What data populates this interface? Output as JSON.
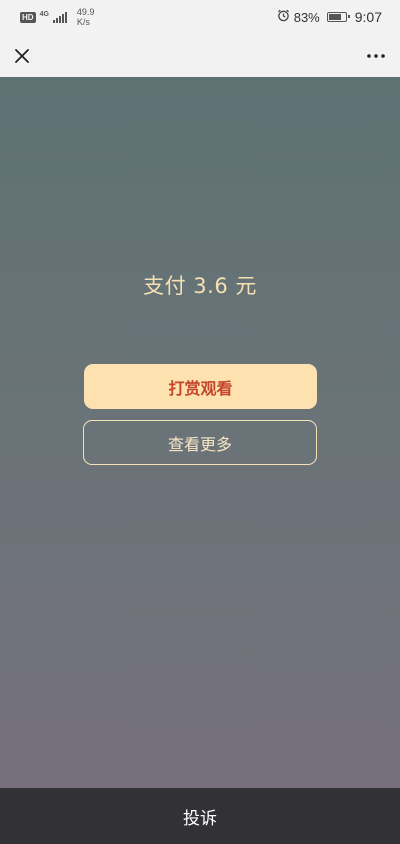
{
  "status_bar": {
    "hd": "HD",
    "network": "4G",
    "speed_value": "49.9",
    "speed_unit": "K/s",
    "battery": "83%",
    "battery_level": 0.83,
    "time": "9:07"
  },
  "nav": {
    "close_icon": "close-icon",
    "more_icon": "more-dots-icon"
  },
  "main": {
    "pay_text": "支付 3.6 元",
    "reward_button": "打赏观看",
    "more_button": "查看更多"
  },
  "footer": {
    "report_label": "投诉"
  },
  "colors": {
    "gradient_top": "#5e7173",
    "gradient_bottom": "#75707c",
    "gold_text": "#f7e0b3",
    "reward_bg": "#fde2b0",
    "reward_text": "#c4452c",
    "footer_bg": "#323236"
  }
}
